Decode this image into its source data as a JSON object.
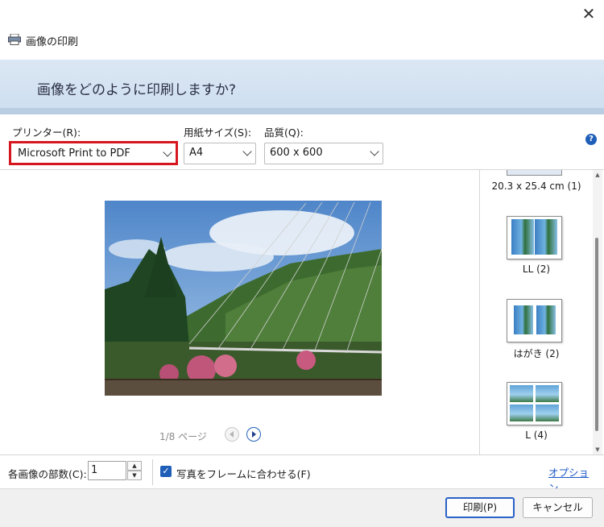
{
  "window": {
    "title": "画像の印刷",
    "heading": "画像をどのように印刷しますか?",
    "close_glyph": "✕"
  },
  "printer": {
    "label": "プリンター(R):",
    "value": "Microsoft Print to PDF"
  },
  "paper_size": {
    "label": "用紙サイズ(S):",
    "value": "A4"
  },
  "quality": {
    "label": "品質(Q):",
    "value": "600 x 600"
  },
  "help_glyph": "?",
  "preview": {
    "page_text": "1/8 ページ"
  },
  "layouts": [
    {
      "label": "20.3 x 25.4 cm (1)"
    },
    {
      "label": "LL (2)"
    },
    {
      "label": "はがき (2)"
    },
    {
      "label": "L (4)"
    }
  ],
  "copies": {
    "label": "各画像の部数(C):",
    "value": "1"
  },
  "fit_frame": {
    "label": "写真をフレームに合わせる(F)",
    "checked": true,
    "check_glyph": "✓"
  },
  "options_link": "オプション...",
  "buttons": {
    "print": "印刷(P)",
    "cancel": "キャンセル"
  },
  "colors": {
    "accent": "#1f5fb8",
    "highlight": "#d6161e",
    "banner": "#d3e2f2"
  },
  "icons": [
    "printer-icon",
    "close-icon",
    "help-icon",
    "chevron-down-icon",
    "prev-page-icon",
    "next-page-icon",
    "checkmark-icon"
  ]
}
